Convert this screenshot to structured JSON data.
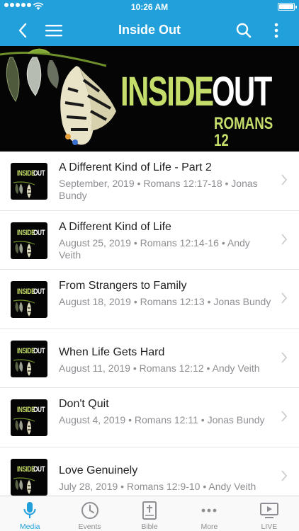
{
  "status": {
    "time": "10:26 AM"
  },
  "header": {
    "title": "Inside Out"
  },
  "banner": {
    "word1": "INSIDE",
    "word2": "OUT",
    "subtitle": "ROMANS 12"
  },
  "thumb": {
    "word1": "INSIDE",
    "word2": "OUT"
  },
  "sermons": [
    {
      "title": "A Different Kind of Life - Part 2",
      "meta": "September, 2019 • Romans 12:17-18 • Jonas Bundy"
    },
    {
      "title": "A Different Kind of Life",
      "meta": "August 25, 2019 • Romans 12:14-16 • Andy Veith"
    },
    {
      "title": "From Strangers to Family",
      "meta": "August 18, 2019 • Romans 12:13 • Jonas Bundy"
    },
    {
      "title": "When Life Gets Hard",
      "meta": "August 11, 2019 • Romans 12:12 • Andy Veith"
    },
    {
      "title": "Don't Quit",
      "meta": "August 4, 2019 • Romans 12:11 • Jonas Bundy"
    },
    {
      "title": "Love Genuinely",
      "meta": "July 28, 2019 • Romans 12:9-10 • Andy Veith"
    }
  ],
  "tabs": [
    {
      "label": "Media",
      "icon": "microphone-icon",
      "active": true
    },
    {
      "label": "Events",
      "icon": "clock-icon",
      "active": false
    },
    {
      "label": "Bible",
      "icon": "bible-icon",
      "active": false
    },
    {
      "label": "More",
      "icon": "ellipsis-icon",
      "active": false
    },
    {
      "label": "LIVE",
      "icon": "live-tv-icon",
      "active": false
    }
  ],
  "colors": {
    "brand": "#22a0db",
    "banner_green": "#c5dd6a",
    "secondary_text": "#8e8e93"
  }
}
